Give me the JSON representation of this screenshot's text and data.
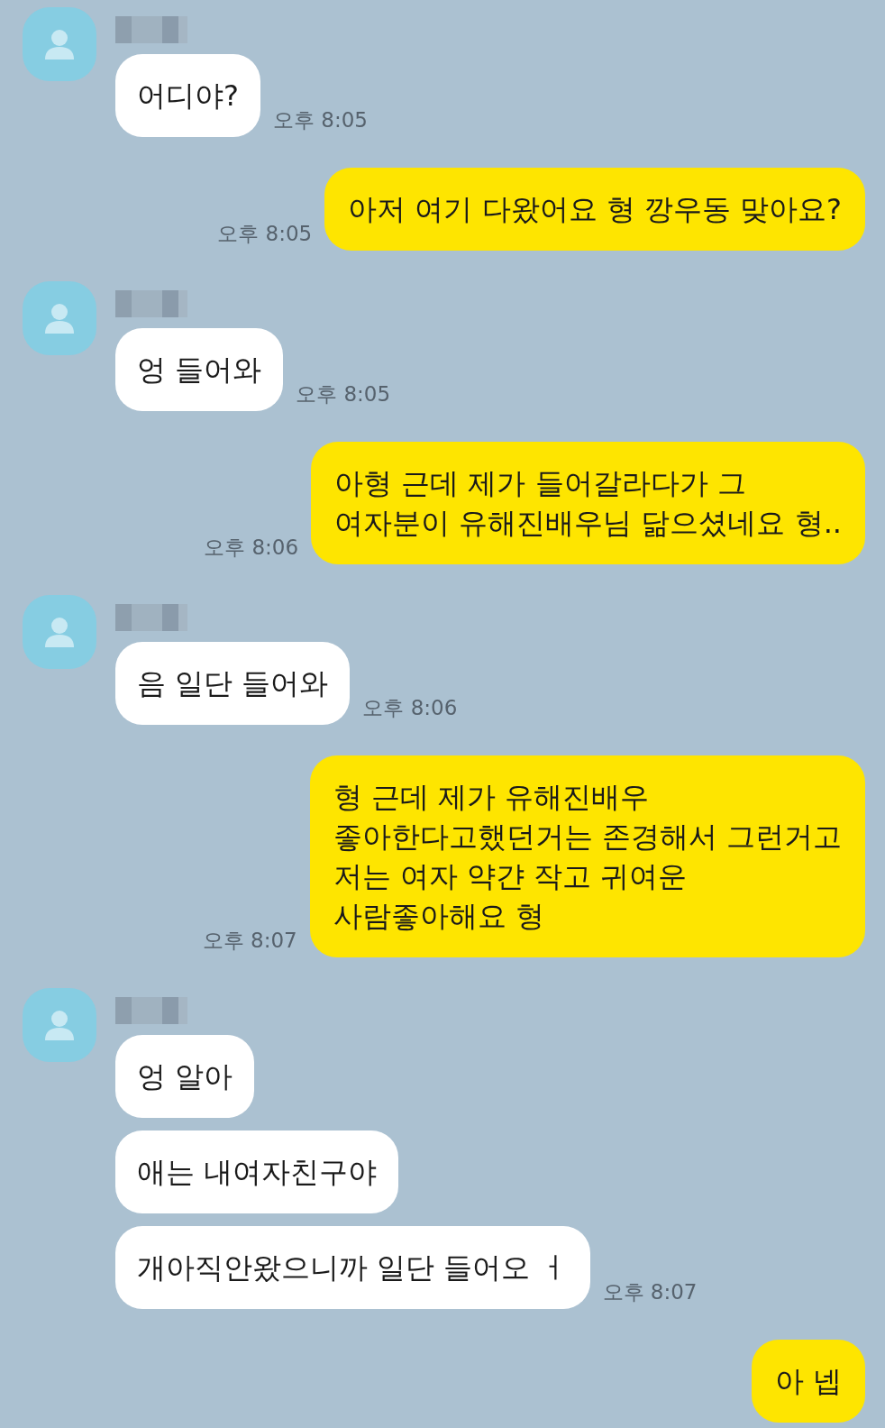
{
  "messages": [
    {
      "kind": "received",
      "bubbles": [
        "어디야?"
      ],
      "time": "오후 8:05"
    },
    {
      "kind": "sent",
      "lines": [
        "아저 여기 다왔어요 형 깡우동 맞아요?"
      ],
      "time": "오후 8:05"
    },
    {
      "kind": "received",
      "bubbles": [
        "엉 들어와"
      ],
      "time": "오후 8:05"
    },
    {
      "kind": "sent",
      "lines": [
        "아형 근데 제가 들어갈라다가 그",
        "여자분이 유해진배우님 닮으셨네요 형.."
      ],
      "time": "오후 8:06"
    },
    {
      "kind": "received",
      "bubbles": [
        "음 일단 들어와"
      ],
      "time": "오후 8:06"
    },
    {
      "kind": "sent",
      "lines": [
        "형 근데 제가 유해진배우",
        "좋아한다고했던거는 존경해서 그런거고",
        "저는 여자 약갼 작고 귀여운",
        "사람좋아해요 형"
      ],
      "time": "오후 8:07"
    },
    {
      "kind": "received",
      "bubbles": [
        "엉 알아",
        "애는 내여자친구야",
        "개아직안왔으니까 일단 들어오 ㅓ"
      ],
      "time": "오후 8:07"
    },
    {
      "kind": "sent",
      "lines": [
        "아 넵"
      ]
    }
  ]
}
